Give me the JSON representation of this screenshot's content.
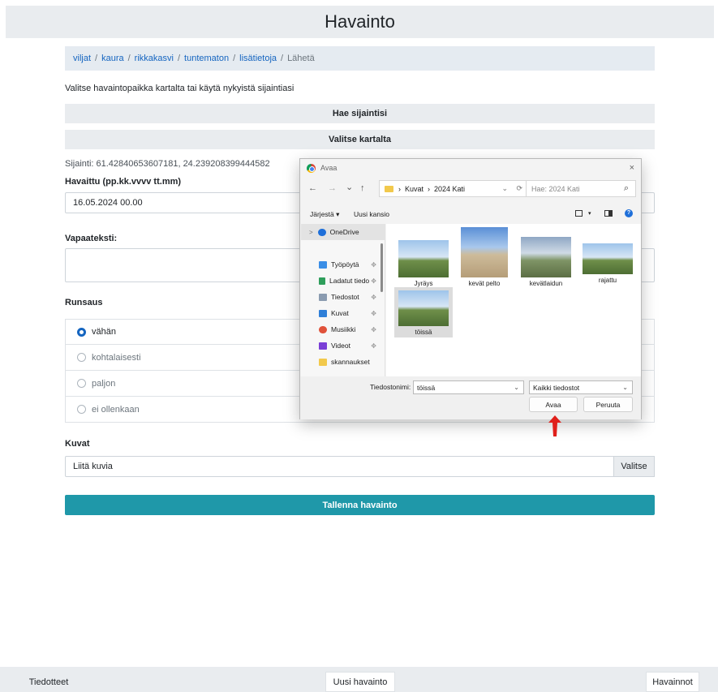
{
  "header": {
    "title": "Havainto"
  },
  "breadcrumb": {
    "links": [
      "viljat",
      "kaura",
      "rikkakasvi",
      "tuntematon",
      "lisätietoja"
    ],
    "current": "Lähetä",
    "separator": "/"
  },
  "location": {
    "instruction": "Valitse havaintopaikka kartalta tai käytä nykyistä sijaintiasi",
    "locate_button": "Hae sijaintisi",
    "map_button": "Valitse kartalta",
    "coords_text": "Sijainti: 61.42840653607181, 24.239208399444582"
  },
  "observed": {
    "label": "Havaittu (pp.kk.vvvv tt.mm)",
    "value": "16.05.2024 00.00"
  },
  "freetext": {
    "label": "Vapaateksti:",
    "value": ""
  },
  "abundance": {
    "label": "Runsaus",
    "options": [
      "vähän",
      "kohtalaisesti",
      "paljon",
      "ei ollenkaan"
    ],
    "selected": "vähän"
  },
  "images": {
    "label": "Kuvat",
    "placeholder": "Liitä kuvia",
    "choose_button": "Valitse"
  },
  "save_button": "Tallenna havainto",
  "footer": {
    "left": "Tiedotteet",
    "center": "Uusi havainto",
    "right": "Havainnot"
  },
  "dialog": {
    "title": "Avaa",
    "close": "×",
    "nav": {
      "back": "←",
      "forward": "→",
      "history": "⌄",
      "up": "↑"
    },
    "address": {
      "sep": "›",
      "part1": "Kuvat",
      "part2": "2024 Kati",
      "chevron": "⌄",
      "refresh": "⟳"
    },
    "search_placeholder": "Hae: 2024 Kati",
    "search_glyph": "⌕",
    "organize": "Järjestä ▾",
    "new_folder": "Uusi kansio",
    "nav_items": [
      {
        "label": "OneDrive",
        "color": "#1e6fd9"
      },
      {
        "label": "Työpöytä",
        "color": "#3a8ee6"
      },
      {
        "label": "Ladatut tiedo",
        "color": "#2e9e5b"
      },
      {
        "label": "Tiedostot",
        "color": "#8a9bb0"
      },
      {
        "label": "Kuvat",
        "color": "#2f7fd8"
      },
      {
        "label": "Musiikki",
        "color": "#e0523a"
      },
      {
        "label": "Videot",
        "color": "#7a3ed6"
      },
      {
        "label": "skannaukset",
        "color": "#f2c94c"
      }
    ],
    "pin_glyph": "✥",
    "expand_glyph": ">",
    "files": [
      "Jyräys",
      "kevät pelto",
      "kevätlaidun",
      "rajattu",
      "töissä"
    ],
    "selected_file": "töissä",
    "filename_label": "Tiedostonimi:",
    "filename_value": "töissä",
    "filter_value": "Kaikki tiedostot",
    "open_button": "Avaa",
    "cancel_button": "Peruuta"
  },
  "colors": {
    "accent": "#1f98a9",
    "link": "#1565c0",
    "annotation_arrow": "#e0201b"
  }
}
